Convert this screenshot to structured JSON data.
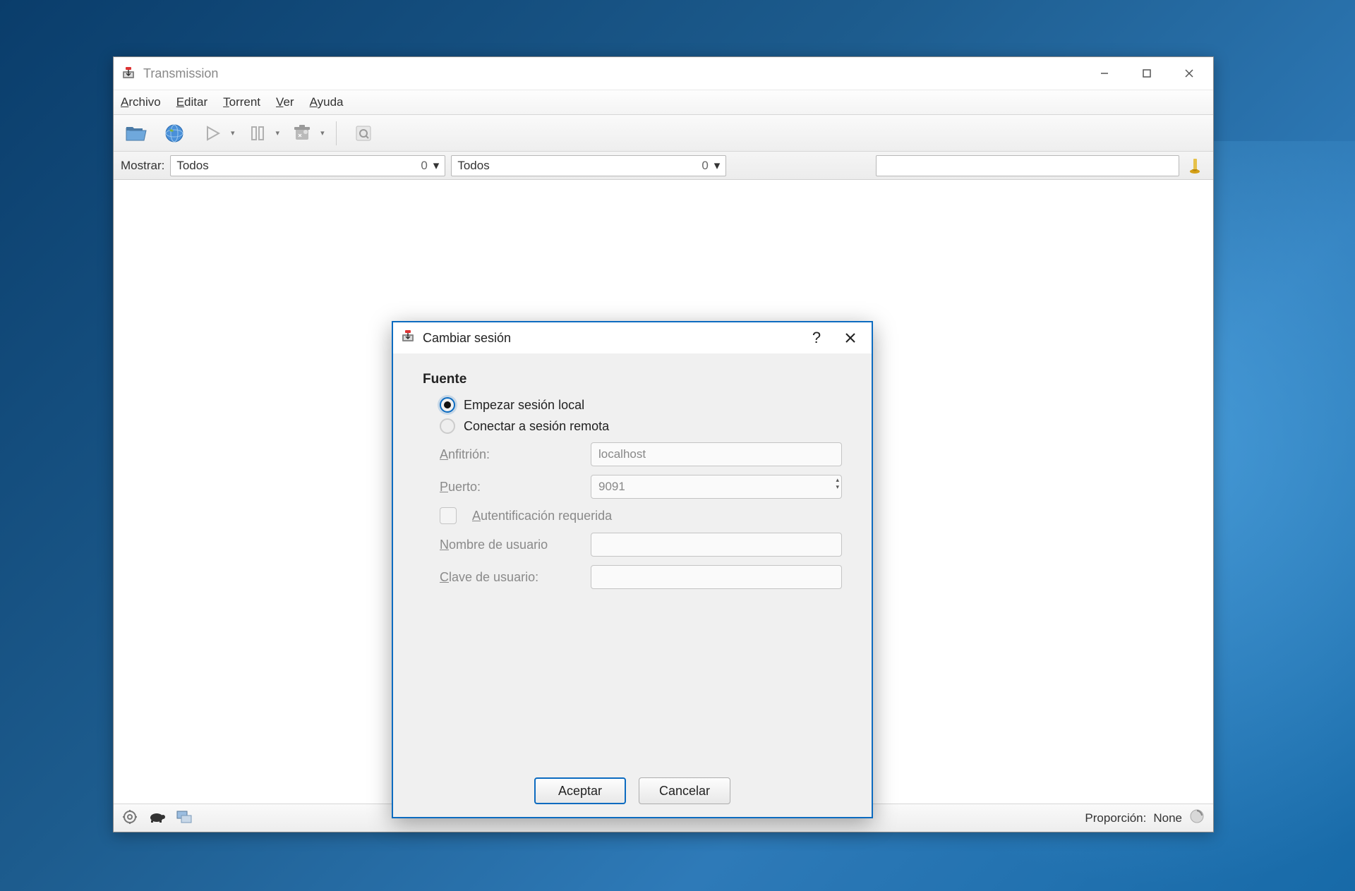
{
  "window": {
    "title": "Transmission",
    "menus": {
      "archivo": "Archivo",
      "editar": "Editar",
      "torrent": "Torrent",
      "ver": "Ver",
      "ayuda": "Ayuda"
    }
  },
  "filter": {
    "label": "Mostrar:",
    "select1_value": "Todos",
    "select1_count": "0",
    "select2_value": "Todos",
    "select2_count": "0"
  },
  "statusbar": {
    "ratio_label": "Proporción:",
    "ratio_value": "None"
  },
  "dialog": {
    "title": "Cambiar sesión",
    "section": "Fuente",
    "radio_local": "Empezar sesión local",
    "radio_remote": "Conectar a sesión remota",
    "host_label": "Anfitrión:",
    "host_value": "localhost",
    "port_label": "Puerto:",
    "port_value": "9091",
    "auth_label": "Autentificación requerida",
    "user_label": "Nombre de usuario",
    "pass_label": "Clave de usuario:",
    "ok": "Aceptar",
    "cancel": "Cancelar"
  }
}
